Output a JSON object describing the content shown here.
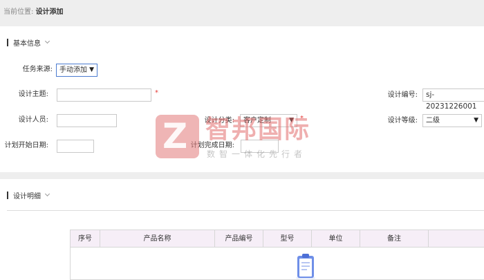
{
  "breadcrumb": {
    "prefix": "当前位置:",
    "current": "设计添加"
  },
  "sections": {
    "basic": {
      "title": "基本信息"
    },
    "detail": {
      "title": "设计明细"
    }
  },
  "form": {
    "task_source": {
      "label": "任务来源:",
      "value": "手动添加"
    },
    "design_topic": {
      "label": "设计主题:",
      "value": "",
      "required_mark": "*"
    },
    "design_code": {
      "label": "设计编号:",
      "value": "sj-20231226001"
    },
    "designer": {
      "label": "设计人员:",
      "value": ""
    },
    "design_category": {
      "label": "设计分类:",
      "value": "客户定制",
      "required_mark": "*"
    },
    "design_level": {
      "label": "设计等级:",
      "value": "二级"
    },
    "plan_start_date": {
      "label": "计划开始日期:",
      "value": ""
    },
    "plan_finish_date": {
      "label": "计划完成日期:",
      "value": ""
    }
  },
  "table": {
    "columns": [
      "序号",
      "产品名称",
      "产品编号",
      "型号",
      "单位",
      "备注"
    ]
  },
  "watermark": {
    "logo_letter": "Z",
    "brand": "智邦国际",
    "slogan": "数智一体化先行者"
  },
  "colors": {
    "accent": "#4a7bd0",
    "required": "#e53935",
    "table_header_bg": "#f6eef7",
    "watermark": "#e17878"
  },
  "icons": {
    "empty_state": "clipboard-icon",
    "section_toggle": "chevron-down-icon",
    "dropdown": "caret-down-icon"
  }
}
